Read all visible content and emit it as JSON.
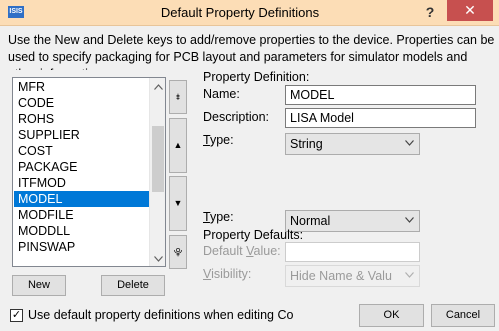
{
  "window": {
    "title": "Default Property Definitions",
    "app_icon_text": "ISIS",
    "help_glyph": "?",
    "close_glyph": "✕"
  },
  "instructions": "Use the New and Delete keys to add/remove properties to the device. Properties can be used to specify packaging for PCB layout and parameters for simulator models and other information.",
  "property_list": {
    "items": [
      "MFR",
      "CODE",
      "ROHS",
      "SUPPLIER",
      "COST",
      "PACKAGE",
      "ITFMOD",
      "MODEL",
      "MODFILE",
      "MODDLL",
      "PINSWAP"
    ],
    "selected": "MODEL"
  },
  "move_buttons": {
    "top": "⯒",
    "up": "▲",
    "down": "▼",
    "bottom": "⯓"
  },
  "list_buttons": {
    "new": "New",
    "delete": "Delete"
  },
  "definition": {
    "group_label": "Property Definition:",
    "name_label": "Name:",
    "name_value": "MODEL",
    "description_label": "Description:",
    "description_value": "LISA Model",
    "type_label_prefix": "T",
    "type_label_rest": "ype:",
    "type_value": "String",
    "type2_label_prefix": "T",
    "type2_label_rest": "ype:",
    "type2_value": "Normal"
  },
  "defaults": {
    "group_label": "Property Defaults:",
    "default_value_label_a": "Default ",
    "default_value_label_u": "V",
    "default_value_label_b": "alue:",
    "default_value": "",
    "visibility_label_u": "V",
    "visibility_label_rest": "isibility:",
    "visibility_value": "Hide Name & Valu"
  },
  "footer": {
    "checkbox_checked": true,
    "checkbox_mark": "✓",
    "checkbox_label": "Use default property definitions when editing Co",
    "ok": "OK",
    "cancel": "Cancel"
  }
}
